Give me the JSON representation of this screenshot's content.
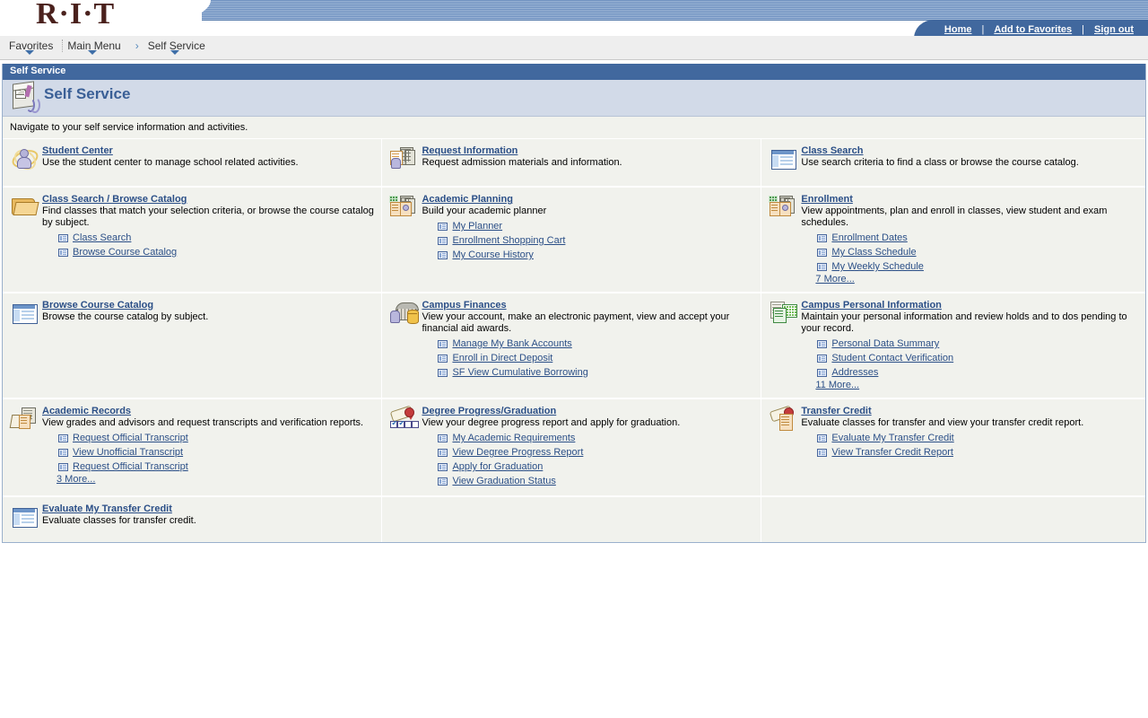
{
  "brand": {
    "logo_text": "R·I·T"
  },
  "header_links": [
    {
      "label": "Home"
    },
    {
      "label": "Add to Favorites"
    },
    {
      "label": "Sign out"
    }
  ],
  "header_separator": "|",
  "breadcrumb": {
    "items": [
      {
        "label": "Favorites",
        "has_caret": true
      },
      {
        "label": "Main Menu",
        "has_caret": true
      },
      {
        "label": "Self Service",
        "has_caret": true
      }
    ],
    "arrow": "›"
  },
  "page": {
    "titlebar": "Self Service",
    "title": "Self Service",
    "title_icon": "self-service-box-icon",
    "instructions": "Navigate to your self service information and activities."
  },
  "grid": {
    "rows": [
      [
        {
          "icon": "student-center-icon",
          "title": "Student Center",
          "desc": "Use the student center to manage school related activities.",
          "links": [],
          "more": null
        },
        {
          "icon": "request-information-icon",
          "title": "Request Information",
          "desc": "Request admission materials and information.",
          "links": [],
          "more": null
        },
        {
          "icon": "class-search-icon",
          "title": "Class Search",
          "desc": "Use search criteria to find a class or browse the course catalog.",
          "links": [],
          "more": null
        }
      ],
      [
        {
          "icon": "folder-icon",
          "title": "Class Search / Browse Catalog",
          "desc": "Find classes that match your selection criteria, or browse the course catalog by subject.",
          "links": [
            {
              "label": "Class Search"
            },
            {
              "label": "Browse Course Catalog"
            }
          ],
          "more": null
        },
        {
          "icon": "academic-planning-icon",
          "title": "Academic Planning",
          "desc": "Build your academic planner",
          "links": [
            {
              "label": "My Planner"
            },
            {
              "label": "Enrollment Shopping Cart"
            },
            {
              "label": "My Course History"
            }
          ],
          "more": null
        },
        {
          "icon": "enrollment-icon",
          "title": "Enrollment",
          "desc": "View appointments, plan and enroll in classes, view student and exam schedules.",
          "links": [
            {
              "label": "Enrollment Dates"
            },
            {
              "label": "My Class Schedule"
            },
            {
              "label": "My Weekly Schedule"
            }
          ],
          "more": "7 More..."
        }
      ],
      [
        {
          "icon": "browse-course-catalog-icon",
          "title": "Browse Course Catalog",
          "desc": "Browse the course catalog by subject.",
          "links": [],
          "more": null
        },
        {
          "icon": "campus-finances-icon",
          "title": "Campus Finances",
          "desc": "View your account, make an electronic payment, view and accept your financial aid awards.",
          "links": [
            {
              "label": "Manage My Bank Accounts"
            },
            {
              "label": "Enroll in Direct Deposit"
            },
            {
              "label": "SF View Cumulative Borrowing"
            }
          ],
          "more": null
        },
        {
          "icon": "campus-personal-information-icon",
          "title": "Campus Personal Information",
          "desc": "Maintain your personal information and review holds and to dos pending to your record.",
          "links": [
            {
              "label": "Personal Data Summary"
            },
            {
              "label": "Student Contact Verification"
            },
            {
              "label": "Addresses"
            }
          ],
          "more": "11 More..."
        }
      ],
      [
        {
          "icon": "academic-records-icon",
          "title": "Academic Records",
          "desc": "View grades and advisors and request transcripts and verification reports.",
          "links": [
            {
              "label": "Request Official Transcript"
            },
            {
              "label": "View Unofficial Transcript"
            },
            {
              "label": "Request Official Transcript"
            }
          ],
          "more": "3 More..."
        },
        {
          "icon": "degree-progress-icon",
          "title": "Degree Progress/Graduation",
          "desc": "View your degree progress report and apply for graduation.",
          "links": [
            {
              "label": "My Academic Requirements"
            },
            {
              "label": "View Degree Progress Report"
            },
            {
              "label": "Apply for Graduation"
            },
            {
              "label": "View Graduation Status"
            }
          ],
          "more": null
        },
        {
          "icon": "transfer-credit-icon",
          "title": "Transfer Credit",
          "desc": "Evaluate classes for transfer and view your transfer credit report.",
          "links": [
            {
              "label": "Evaluate My Transfer Credit"
            },
            {
              "label": "View Transfer Credit Report"
            }
          ],
          "more": null
        }
      ],
      [
        {
          "icon": "evaluate-my-transfer-credit-icon",
          "title": "Evaluate My Transfer Credit",
          "desc": "Evaluate classes for transfer credit.",
          "links": [],
          "more": null
        },
        null,
        null
      ]
    ]
  },
  "colors": {
    "brand_maroon": "#4a211d",
    "accent_blue": "#41689e",
    "link_blue": "#2b4f87",
    "panel_bg": "#f1f2ed",
    "header_bg": "#d2dae8"
  }
}
